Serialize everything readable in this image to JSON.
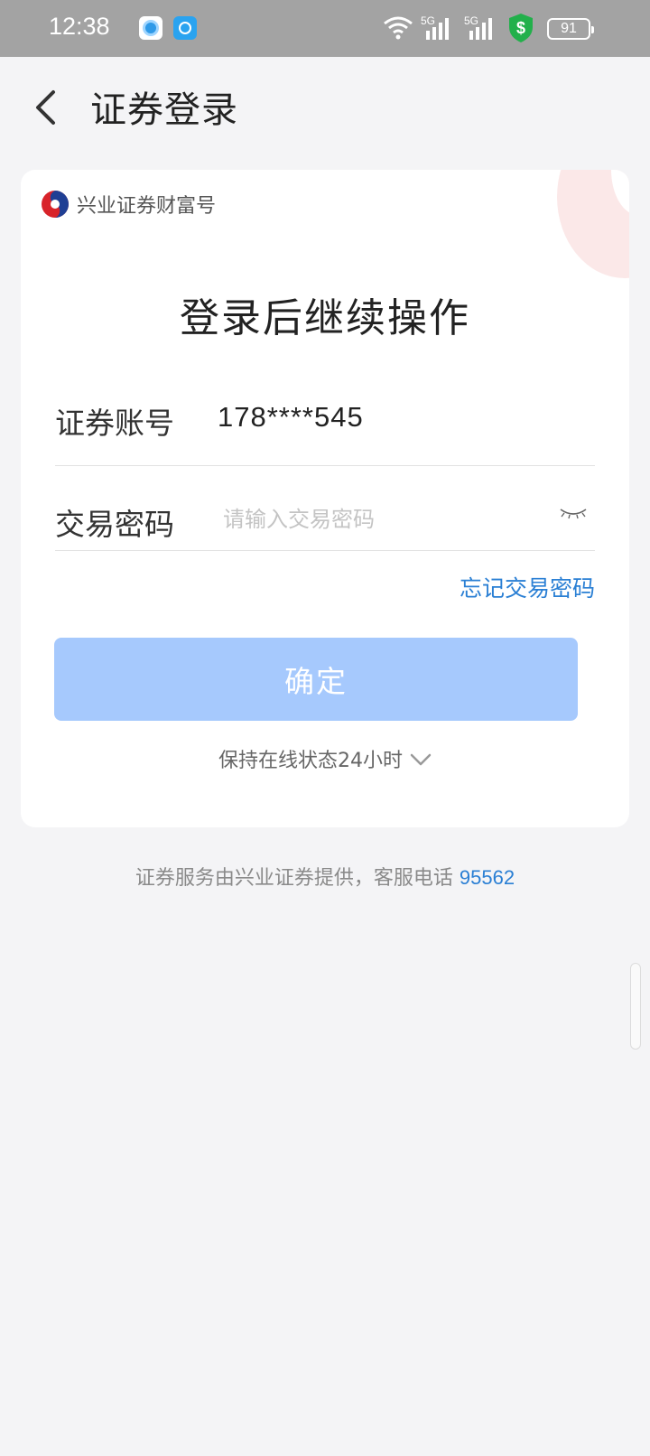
{
  "status_bar": {
    "time": "12:38",
    "network_1": "5G",
    "network_2": "5G",
    "battery": "91",
    "icons": [
      "app-icon",
      "app-icon",
      "wifi-icon",
      "signal-icon",
      "signal-icon",
      "shield-icon",
      "battery-icon"
    ]
  },
  "header": {
    "title": "证券登录",
    "back_icon": "chevron-left-icon"
  },
  "card": {
    "brand_name": "兴业证券财富号",
    "brand_logo": "brand-logo-icon",
    "heading": "登录后继续操作",
    "account": {
      "label": "证券账号",
      "value": "178****545"
    },
    "password": {
      "label": "交易密码",
      "placeholder": "请输入交易密码",
      "toggle_icon": "eye-closed-icon"
    },
    "forgot_label": "忘记交易密码",
    "confirm_label": "确定",
    "stay_online_label": "保持在线状态24小时",
    "stay_online_icon": "chevron-down-icon"
  },
  "footer": {
    "text": "证券服务由兴业证券提供，客服电话 ",
    "phone": "95562"
  },
  "colors": {
    "accent": "#2a7fd4",
    "button_disabled": "#a6c9fd",
    "status_bar": "#a3a3a3",
    "background": "#f4f4f6"
  }
}
